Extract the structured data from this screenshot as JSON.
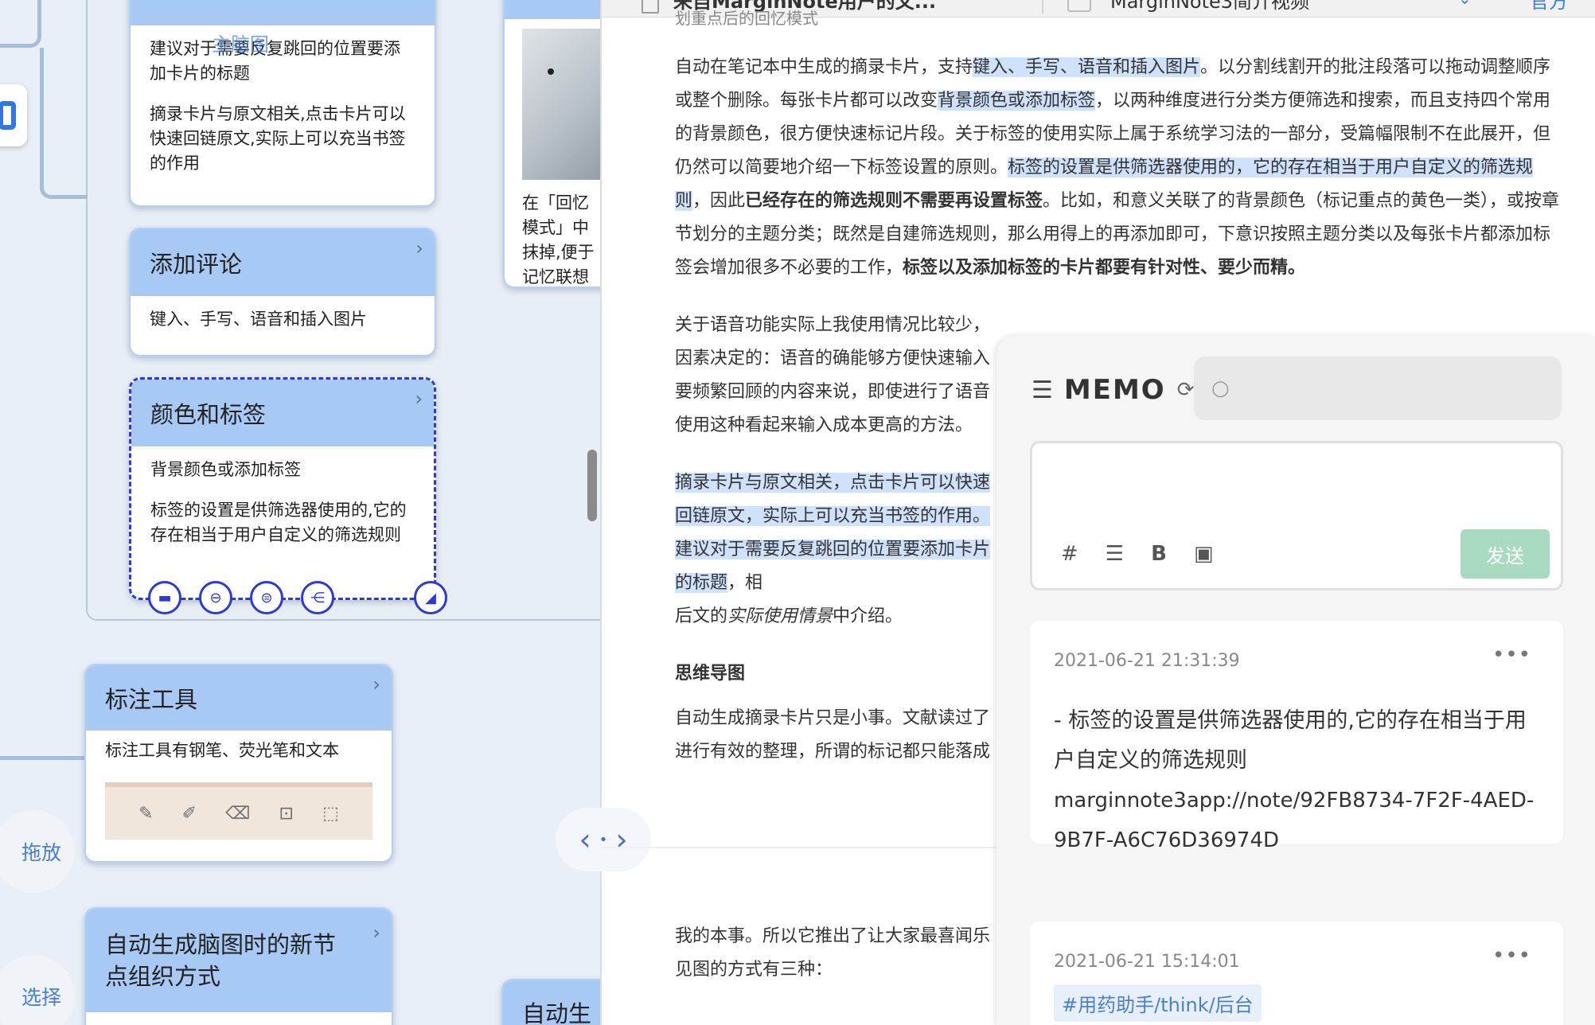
{
  "tabs": [
    {
      "label": "来自MarginNote用户的文..."
    },
    {
      "label": "MarginNote3简介视频"
    },
    {
      "label": "官方"
    }
  ],
  "mindmap": {
    "cards": [
      {
        "id": "jianyi",
        "title": "",
        "body": [
          "建议对于需要反复跳回的位置要添加卡片的标题",
          "摘录卡片与原文相关,点击卡片可以快速回链原文,实际上可以充当书签的作用"
        ]
      },
      {
        "id": "pinglun",
        "title": "添加评论",
        "body": [
          "键入、手写、语音和插入图片"
        ]
      },
      {
        "id": "yanse",
        "title": "颜色和标签",
        "body": [
          "背景颜色或添加标签",
          "标签的设置是供筛选器使用的,它的存在相当于用户自定义的筛选规则"
        ]
      },
      {
        "id": "biaozhu",
        "title": "标注工具",
        "body": [
          "标注工具有钢笔、荧光笔和文本"
        ]
      },
      {
        "id": "naotu",
        "title": "自动生成脑图时的新节点组织方式",
        "body": []
      },
      {
        "id": "zidong",
        "title": "自动生",
        "body": []
      },
      {
        "id": "huiyi",
        "title": "",
        "body": [
          "在「回忆模式」中抹掉,便于记忆联想记忆法"
        ]
      }
    ],
    "overlay_text": "主脑图",
    "side_buttons": {
      "drag": "拖放",
      "select": "选择"
    }
  },
  "article": {
    "top_line": "划重点后的回忆模式",
    "p1_pre": "自动在笔记本中生成的摘录卡片，支持",
    "p1_hl1": "键入、手写、语音和插入图片",
    "p1_mid1": "。以分割线割开的批注段落可以拖动调整顺序或整个删除。每张卡片都可以改变",
    "p1_hl2": "背景颜色或添加标签",
    "p1_mid2": "，以两种维度进行分类方便筛选和搜索，而且支持四个常用的背景颜色，很方便快速标记片段。关于标签的使用实际上属于系统学习法的一部分，受篇幅限制不在此展开，但仍然可以简要地介绍一下标签设置的原则。",
    "p1_hl3": "标签的设置是供筛选器使用的，它的存在相当于用户自定义的筛选规则",
    "p1_mid3": "，因此",
    "p1_b1": "已经存在的筛选规则不需要再设置标签",
    "p1_mid4": "。比如，和意义关联了的背景颜色（标记重点的黄色一类），或按章节划分的主题分类；既然是自建筛选规则，那么用得上的再添加即可，下意识按照主题分类以及每张卡片都添加标签会增加很多不必要的工作，",
    "p1_b2": "标签以及添加标签的卡片都要有针对性、要少而精。",
    "p2": "关于语音功能实际上我使用情况比较少，因素决定的：语音的确能够方便快速输入要频繁回顾的内容来说，即使进行了语音使用这种看起来输入成本更高的方法。",
    "p3_hl": "摘录卡片与原文相关，点击卡片可以快速回链原文，实际上可以充当书签的作用。建议对于需要反复跳回的位置要添加卡片的标题",
    "p3_rest": "，相",
    "p3_line3_pre": "后文的",
    "p3_line3_i": "实际使用情景",
    "p3_line3_post": "中介绍。",
    "heading": "思维导图",
    "p4": "自动生成摘录卡片只是小事。文献读过了进行有效的整理，所谓的标记都只能落成",
    "p5": "我的本事。所以它推出了让大家最喜闻乐见图的方式有三种："
  },
  "memo": {
    "title": "MEMO",
    "search_placeholder": "",
    "editor_placeholder": "",
    "send_label": "发送",
    "entries": [
      {
        "time": "2021-06-21 21:31:39",
        "text": "- 标签的设置是供筛选器使用的,它的存在相当于用户自定义的筛选规则",
        "link": "marginnote3app://note/92FB8734-7F2F-4AED-9B7F-A6C76D36974D"
      },
      {
        "time": "2021-06-21 15:14:01",
        "tag": "#用药助手/think/后台"
      }
    ]
  },
  "colors": {
    "card_header": "#a9c9f5",
    "selection": "#2d3bd6",
    "highlight": "#cfe1fb",
    "send_button": "#a7dac0",
    "tag_text": "#4a7fd1"
  }
}
